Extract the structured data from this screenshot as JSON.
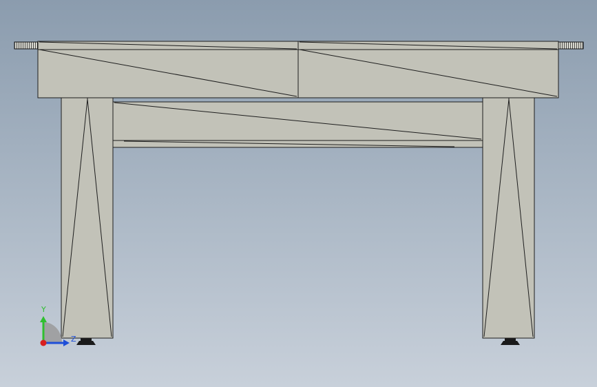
{
  "viewport": {
    "background_top": "#8b9cae",
    "background_bottom": "#c8d0da",
    "part_fill": "#c2c2b8",
    "edge_color": "#1c1c1c"
  },
  "triad": {
    "y_label": "Y",
    "z_label": "Z",
    "y_color": "#2fbf2f",
    "z_color": "#1f4fd8",
    "x_color": "#d81f1f",
    "origin_icon": "axis-origin-icon"
  }
}
